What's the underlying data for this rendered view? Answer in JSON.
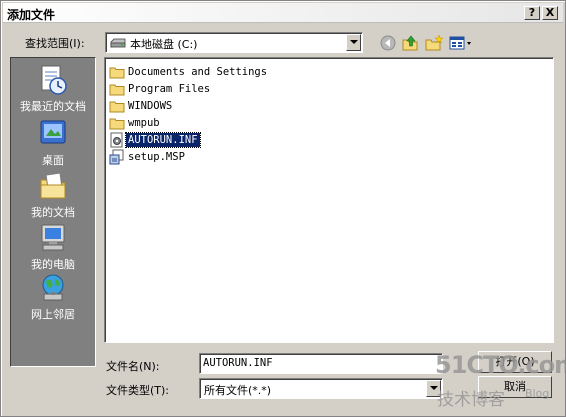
{
  "window": {
    "title": "添加文件",
    "help_label": "?",
    "close_label": "X"
  },
  "lookin": {
    "label": "查找范围(I):",
    "value": "本地磁盘 (C:)"
  },
  "toolbar": {
    "back_icon": "back-arrow-icon",
    "up_icon": "up-folder-icon",
    "newfolder_icon": "new-folder-icon",
    "view_icon": "view-menu-icon"
  },
  "places": [
    {
      "label": "我最近的文档",
      "icon": "recent-documents-icon"
    },
    {
      "label": "桌面",
      "icon": "desktop-icon"
    },
    {
      "label": "我的文档",
      "icon": "my-documents-icon"
    },
    {
      "label": "我的电脑",
      "icon": "my-computer-icon"
    },
    {
      "label": "网上邻居",
      "icon": "network-places-icon"
    }
  ],
  "files": [
    {
      "name": "Documents and Settings",
      "type": "folder",
      "selected": false
    },
    {
      "name": "Program Files",
      "type": "folder",
      "selected": false
    },
    {
      "name": "WINDOWS",
      "type": "folder",
      "selected": false
    },
    {
      "name": "wmpub",
      "type": "folder",
      "selected": false
    },
    {
      "name": "AUTORUN.INF",
      "type": "inf",
      "selected": true
    },
    {
      "name": "setup.MSP",
      "type": "msp",
      "selected": false
    }
  ],
  "filename": {
    "label": "文件名(N):",
    "value": "AUTORUN.INF"
  },
  "filetype": {
    "label": "文件类型(T):",
    "value": "所有文件(*.*)"
  },
  "buttons": {
    "open": "打开(O)",
    "cancel": "取消"
  },
  "watermark": {
    "line1": "51CTO.com",
    "line2": "技术博客",
    "line3": "Blog"
  },
  "colors": {
    "dialog_bg": "#d4d0c8",
    "places_bg": "#808080",
    "selection": "#0a246a",
    "folder": "#f5d97a"
  }
}
